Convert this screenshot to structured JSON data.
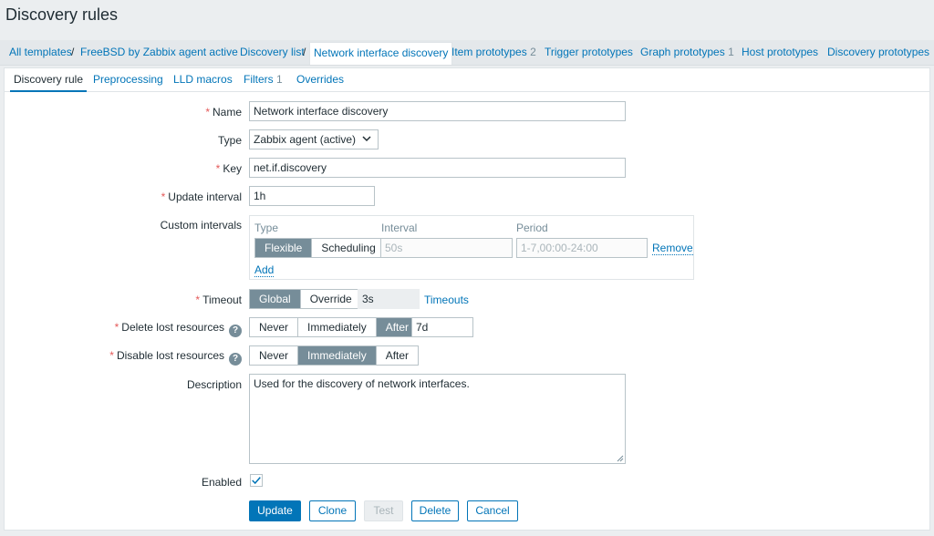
{
  "page": {
    "title": "Discovery rules"
  },
  "breadcrumbs": {
    "all_templates": "All templates",
    "template": "FreeBSD by Zabbix agent active",
    "discovery_list": "Discovery list",
    "current": "Network interface discovery",
    "item_prototypes": "Item prototypes",
    "item_prototypes_count": "2",
    "trigger_prototypes": "Trigger prototypes",
    "graph_prototypes": "Graph prototypes",
    "graph_prototypes_count": "1",
    "host_prototypes": "Host prototypes",
    "discovery_prototypes": "Discovery prototypes",
    "separator": "/"
  },
  "tabs": {
    "discovery_rule": "Discovery rule",
    "preprocessing": "Preprocessing",
    "lld_macros": "LLD macros",
    "filters": "Filters",
    "filters_count": "1",
    "overrides": "Overrides"
  },
  "form": {
    "required_mark": "*",
    "name": {
      "label": "Name",
      "value": "Network interface discovery"
    },
    "type": {
      "label": "Type",
      "value": "Zabbix agent (active)"
    },
    "key": {
      "label": "Key",
      "value": "net.if.discovery"
    },
    "update_interval": {
      "label": "Update interval",
      "value": "1h"
    },
    "custom_intervals": {
      "label": "Custom intervals",
      "col_type": "Type",
      "col_interval": "Interval",
      "col_period": "Period",
      "flexible": "Flexible",
      "scheduling": "Scheduling",
      "interval_placeholder": "50s",
      "period_placeholder": "1-7,00:00-24:00",
      "remove": "Remove",
      "add": "Add",
      "selected": "Flexible"
    },
    "timeout": {
      "label": "Timeout",
      "global": "Global",
      "override": "Override",
      "value": "3s",
      "link": "Timeouts",
      "selected": "Global"
    },
    "delete_lost": {
      "label": "Delete lost resources",
      "never": "Never",
      "immediately": "Immediately",
      "after": "After",
      "value": "7d",
      "selected": "After"
    },
    "disable_lost": {
      "label": "Disable lost resources",
      "never": "Never",
      "immediately": "Immediately",
      "after": "After",
      "selected": "Immediately"
    },
    "help_icon": "?",
    "description": {
      "label": "Description",
      "value": "Used for the discovery of network interfaces."
    },
    "enabled": {
      "label": "Enabled",
      "checked": true
    }
  },
  "buttons": {
    "update": "Update",
    "clone": "Clone",
    "test": "Test",
    "delete": "Delete",
    "cancel": "Cancel"
  },
  "colors": {
    "accent": "#0275b8",
    "required": "#e45959",
    "segment_active": "#768d99"
  }
}
